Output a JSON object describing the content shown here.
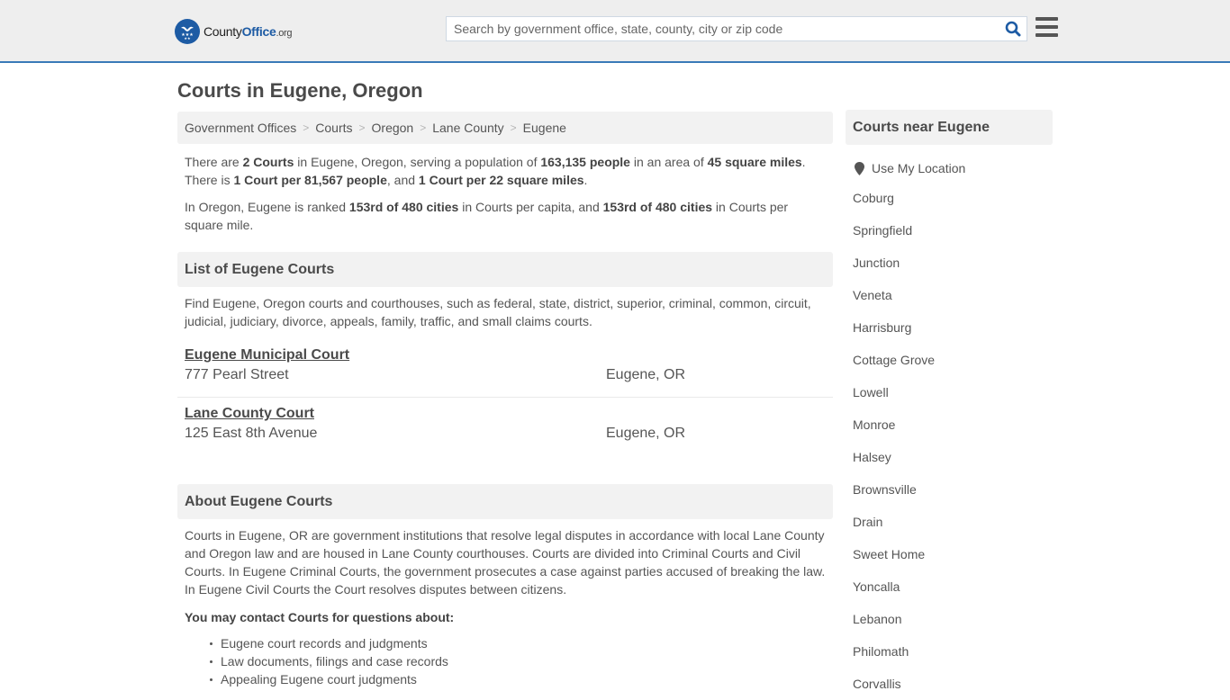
{
  "header": {
    "logo": {
      "name_part1": "County",
      "name_part2": "Office",
      "name_suffix": ".org"
    },
    "search": {
      "placeholder": "Search by government office, state, county, city or zip code",
      "value": ""
    },
    "colors": {
      "accent": "#3a7ab8",
      "brand": "#1d5ba4"
    }
  },
  "page": {
    "title": "Courts in Eugene, Oregon"
  },
  "breadcrumb": [
    {
      "label": "Government Offices"
    },
    {
      "label": "Courts"
    },
    {
      "label": "Oregon"
    },
    {
      "label": "Lane County"
    },
    {
      "label": "Eugene"
    }
  ],
  "summary": {
    "p1": {
      "t1": "There are ",
      "b1": "2 Courts",
      "t2": " in Eugene, Oregon, serving a population of ",
      "b2": "163,135 people",
      "t3": " in an area of ",
      "b3": "45 square miles",
      "t4": ".",
      "t5": "There is ",
      "b4": "1 Court per 81,567 people",
      "t6": ", and ",
      "b5": "1 Court per 22 square miles",
      "t7": "."
    },
    "p2": {
      "t1": "In Oregon, Eugene is ranked ",
      "b1": "153rd of 480 cities",
      "t2": " in Courts per capita, and ",
      "b2": "153rd of 480 cities",
      "t3": " in Courts per square mile."
    }
  },
  "list_section": {
    "heading": "List of Eugene Courts",
    "intro": "Find Eugene, Oregon courts and courthouses, such as federal, state, district, superior, criminal, common, circuit, judicial, judiciary, divorce, appeals, family, traffic, and small claims courts.",
    "courts": [
      {
        "name": "Eugene Municipal Court",
        "address": "777 Pearl Street",
        "city": "Eugene, OR"
      },
      {
        "name": "Lane County Court",
        "address": "125 East 8th Avenue",
        "city": "Eugene, OR"
      }
    ]
  },
  "about_section": {
    "heading": "About Eugene Courts",
    "body": "Courts in Eugene, OR are government institutions that resolve legal disputes in accordance with local Lane County and Oregon law and are housed in Lane County courthouses. Courts are divided into Criminal Courts and Civil Courts. In Eugene Criminal Courts, the government prosecutes a case against parties accused of breaking the law. In Eugene Civil Courts the Court resolves disputes between citizens.",
    "contact_heading": "You may contact Courts for questions about:",
    "contact_items": [
      "Eugene court records and judgments",
      "Law documents, filings and case records",
      "Appealing Eugene court judgments"
    ]
  },
  "sidebar": {
    "heading": "Courts near Eugene",
    "use_location": "Use My Location",
    "cities": [
      "Coburg",
      "Springfield",
      "Junction",
      "Veneta",
      "Harrisburg",
      "Cottage Grove",
      "Lowell",
      "Monroe",
      "Halsey",
      "Brownsville",
      "Drain",
      "Sweet Home",
      "Yoncalla",
      "Lebanon",
      "Philomath",
      "Corvallis"
    ]
  }
}
